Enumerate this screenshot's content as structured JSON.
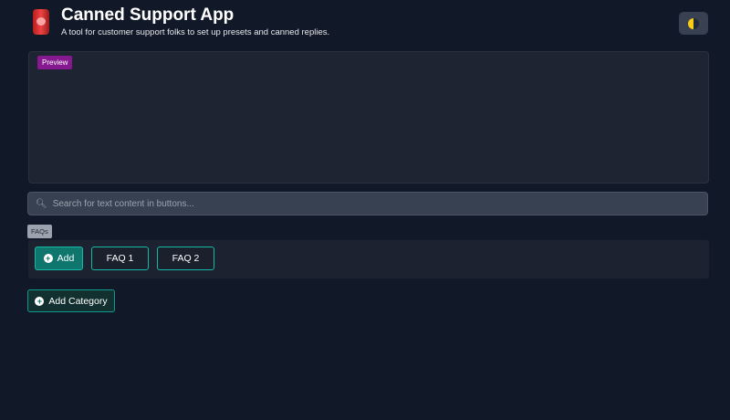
{
  "header": {
    "title": "Canned Support App",
    "subtitle": "A tool for customer support folks to set up presets and canned replies.",
    "theme_icon": "moon-icon"
  },
  "preview": {
    "badge": "Preview"
  },
  "search": {
    "placeholder": "Search for text content in buttons..."
  },
  "categories": [
    {
      "name": "FAQs",
      "add_label": "Add",
      "buttons": [
        "FAQ 1",
        "FAQ 2"
      ]
    }
  ],
  "add_category_label": "Add Category"
}
